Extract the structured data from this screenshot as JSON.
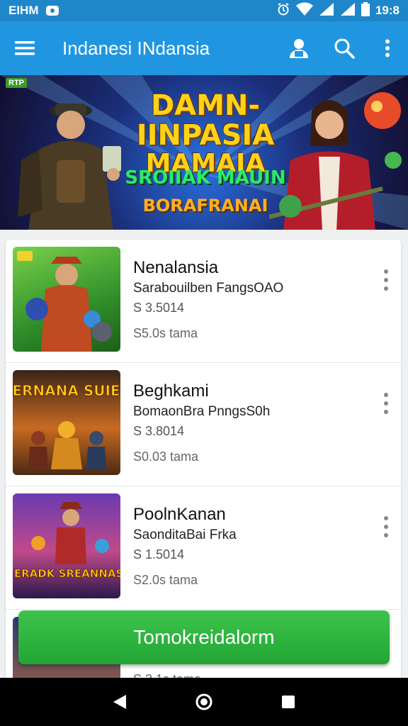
{
  "status_bar": {
    "carrier": "EIHM",
    "time": "19:8",
    "icons": [
      "notification-icon",
      "alarm-icon",
      "wifi-icon",
      "signal-icon",
      "signal-icon",
      "battery-icon"
    ]
  },
  "app_bar": {
    "title": "Indanesi INdansia",
    "icons": [
      "menu-icon",
      "account-icon",
      "search-icon",
      "more-vert-icon"
    ]
  },
  "banner": {
    "tag": "RTP",
    "title_line1": "DAMN- IINPASIA",
    "title_line2": "MAMAIA",
    "subtitle": "SROIIAK MAUIN",
    "subtitle2": "BORAFRANAI"
  },
  "list": {
    "items": [
      {
        "title": "Nenalansia",
        "subtitle": "Sarabouilben FangsOAO",
        "price": "S 3.5014",
        "time": "S5.0s tama",
        "thumb_label": ""
      },
      {
        "title": "Beghkami",
        "subtitle": "BomaonBra PnngsS0h",
        "price": "S 3.8014",
        "time": "S0.03 tama",
        "thumb_label": "SIERNANA SUIEIA"
      },
      {
        "title": "PoolnKanan",
        "subtitle": "SaonditaBai Frka",
        "price": "S 1.5014",
        "time": "S2.0s tama",
        "thumb_label": "SNERADK SREANNASIA"
      },
      {
        "title": "",
        "subtitle": "",
        "price": "",
        "time": "S.3.1s tama",
        "thumb_label": ""
      }
    ]
  },
  "cta": {
    "label": "Tomokreidalorm"
  },
  "nav": {
    "icons": [
      "back-icon",
      "home-icon",
      "recents-icon"
    ]
  },
  "colors": {
    "status_bar": "#1f86c9",
    "app_bar": "#2196e0",
    "cta_green": "#2bb43c",
    "nav_bar": "#000000"
  }
}
